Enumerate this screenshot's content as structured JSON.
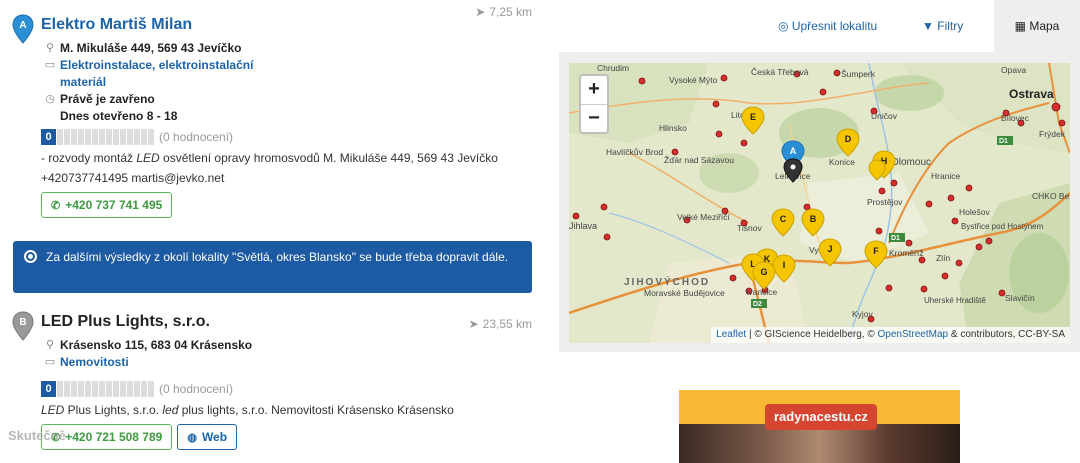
{
  "toolbar": {
    "refine_label": "Upřesnit lokalitu",
    "filter_label": "Filtry",
    "map_label": "Mapa"
  },
  "results": [
    {
      "marker": "A",
      "name": "Elektro Martiš Milan",
      "distance": "7,25 km",
      "address": "M. Mikuláše 449, 569 43 Jevíčko",
      "category": "Elektroinstalace, elektroinstalační materiál",
      "category_line1": "Elektroinstalace, elektroinstalační",
      "category_line2": "materiál",
      "status": "Právě je zavřeno",
      "hours": "Dnes otevřeno 8 - 18",
      "rating_value": "0",
      "rating_label": "(0 hodnocení)",
      "desc_prefix": "- rozvody montáž ",
      "desc_em": "LED",
      "desc_suffix": " osvětlení opravy hromosvodů M. Mikuláše 449, 569 43 Jevíčko",
      "desc_line2": "+420737741495 martis@jevko.net",
      "phone": "+420 737 741 495"
    },
    {
      "marker": "B",
      "name": "LED Plus Lights, s.r.o.",
      "distance": "23,55 km",
      "address": "Krásensko 115, 683 04 Krásensko",
      "category": "Nemovitosti",
      "rating_value": "0",
      "rating_label": "(0 hodnocení)",
      "desc_em1": "LED",
      "desc_mid": " Plus Lights, s.r.o. ",
      "desc_em2": "led",
      "desc_suffix": " plus lights, s.r.o. Nemovitosti Krásensko Krásensko",
      "phone": "+420 721 508 789",
      "web": "Web"
    }
  ],
  "notice": "Za dalšími výsledky z okolí lokality \"Světlá, okres Blansko\" se bude třeba dopravit dále.",
  "map": {
    "zoom_in": "+",
    "zoom_out": "−",
    "attribution_link1": "Leaflet",
    "attribution_mid": " | © GIScience Heidelberg, © ",
    "attribution_link2": "OpenStreetMap",
    "attribution_end": " & contributors, CC-BY-SA",
    "markers": [
      "A",
      "B",
      "C",
      "D",
      "E",
      "F",
      "G",
      "H",
      "I",
      "J",
      "K",
      "L"
    ],
    "place_labels": [
      "Chrudim",
      "Vysoké Mýto",
      "Česká Třebová",
      "Šumperk",
      "Opava",
      "Ostrava",
      "Bílovec",
      "Frýdek",
      "Hlinsko",
      "Havlíčkův Brod",
      "Žďár nad Sázavou",
      "Litomyšl",
      "Uničov",
      "Konice",
      "Olomouc",
      "Prostějov",
      "Hranice",
      "Jihlava",
      "Velké Meziříčí",
      "Tišnov",
      "Vyškov",
      "Kroměříž",
      "Holešov",
      "Bystřice pod Hostýnem",
      "Zlín",
      "JIHOVÝCHOD",
      "Moravské Budějovice",
      "Ivančice",
      "Uherské Hradiště",
      "Kyjov",
      "Slavičín",
      "CHKO Be",
      "Lelkovice"
    ]
  },
  "ad": {
    "badge": "radynacestu.cz"
  },
  "watermark": "Skutečně"
}
